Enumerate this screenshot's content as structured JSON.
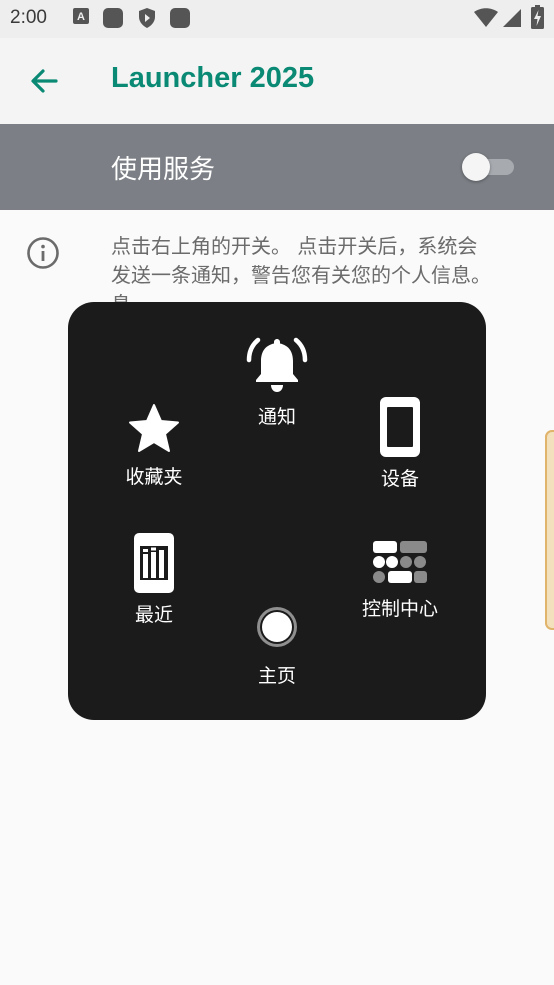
{
  "status_bar": {
    "time": "2:00",
    "icons": [
      "text-notification-icon",
      "app-notification-icon",
      "shield-icon",
      "app-notification-icon",
      "wifi-icon",
      "signal-icon",
      "battery-charging-icon"
    ]
  },
  "app_bar": {
    "title": "Launcher 2025",
    "back_icon": "arrow-left-icon"
  },
  "service": {
    "label": "使用服务",
    "enabled": false
  },
  "info": {
    "icon": "info-icon",
    "text": "点击右上角的开关。 点击开关后，系统会\n发送一条通知，警告您有关您的个人信息。\n                                                               息。\n                                                                     e"
  },
  "panel": {
    "items": [
      {
        "label": "通知",
        "icon": "bell-icon"
      },
      {
        "label": "收藏夹",
        "icon": "star-icon"
      },
      {
        "label": "设备",
        "icon": "phone-device-icon"
      },
      {
        "label": "最近",
        "icon": "recent-apps-icon"
      },
      {
        "label": "控制中心",
        "icon": "control-center-icon"
      },
      {
        "label": "主页",
        "icon": "home-circle-icon"
      }
    ]
  },
  "colors": {
    "accent": "#0a8a74",
    "service_bar": "#7c8086",
    "panel_bg": "#1b1b1b"
  }
}
